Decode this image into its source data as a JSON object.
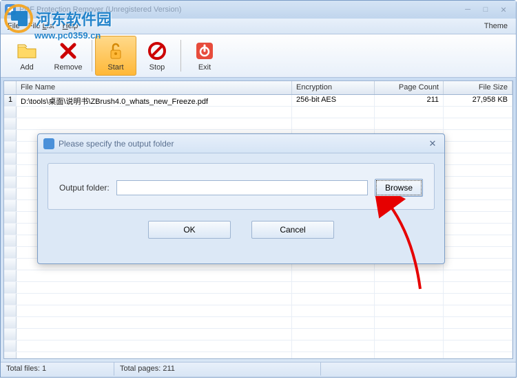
{
  "window": {
    "title": "PDF Protection Remover (Unregistered Version)"
  },
  "menu": {
    "file": "File",
    "filelist": "File List",
    "help": "Help",
    "theme": "Theme"
  },
  "toolbar": {
    "add": "Add",
    "remove": "Remove",
    "start": "Start",
    "stop": "Stop",
    "exit": "Exit"
  },
  "grid": {
    "headers": {
      "filename": "File Name",
      "encryption": "Encryption",
      "pagecount": "Page Count",
      "filesize": "File Size"
    },
    "rows": [
      {
        "num": "1",
        "filename": "D:\\tools\\桌面\\说明书\\ZBrush4.0_whats_new_Freeze.pdf",
        "encryption": "256-bit AES",
        "pagecount": "211",
        "filesize": "27,958 KB"
      }
    ]
  },
  "status": {
    "totalfiles": "Total files: 1",
    "totalpages": "Total pages: 211"
  },
  "dialog": {
    "title": "Please specify the output folder",
    "label": "Output folder:",
    "value": "",
    "browse": "Browse",
    "ok": "OK",
    "cancel": "Cancel"
  },
  "watermark": {
    "text": "河东软件园",
    "url": "www.pc0359.cn"
  }
}
